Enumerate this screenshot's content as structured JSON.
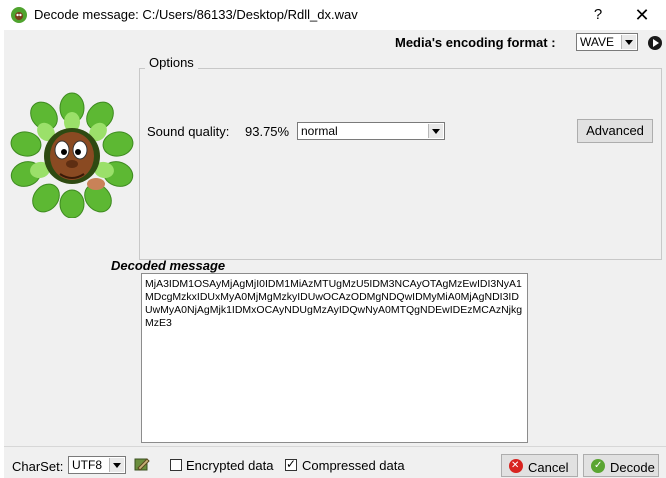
{
  "window": {
    "title": "Decode message: C:/Users/86133/Desktop/Rdll_dx.wav",
    "help": "?",
    "close": "✕"
  },
  "encoding": {
    "label": "Media's encoding format :",
    "value": "WAVE"
  },
  "options": {
    "legend": "Options",
    "sound_quality_label": "Sound quality:",
    "sound_quality_value": "93.75%",
    "quality_select": "normal",
    "advanced_label": "Advanced"
  },
  "decoded": {
    "label": "Decoded message",
    "text": "MjA3IDM1OSAyMjAgMjI0IDM1MiAzMTUgMzU5IDM3NCAyOTAgMzEwIDI3NyA1MDcgMzkxIDUxMyA0MjMgMzkyIDUwOCAzODMgNDQwIDMyMiA0MjAgNDI3IDUwMyA0NjAgMjk1IDMxOCAyNDUgMzAyIDQwNyA0MTQgNDEwIDEzMCAzNjkgMzE3"
  },
  "footer": {
    "charset_label": "CharSet:",
    "charset_value": "UTF8",
    "encrypted_label": "Encrypted data",
    "encrypted_checked": false,
    "compressed_label": "Compressed data",
    "compressed_checked": true,
    "cancel_label": "Cancel",
    "decode_label": "Decode"
  },
  "colors": {
    "accent_ok": "#5aa532",
    "accent_cancel": "#d8231f",
    "mascot_leaf": "#5db833",
    "mascot_skin": "#8a4a22"
  }
}
